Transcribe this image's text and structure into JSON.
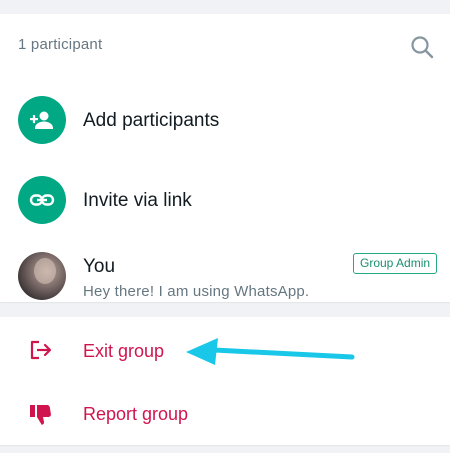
{
  "participants": {
    "count_label": "1 participant",
    "search_icon": "search-icon"
  },
  "actions": {
    "add_participants": {
      "label": "Add participants",
      "icon": "add-person-icon"
    },
    "invite_link": {
      "label": "Invite via link",
      "icon": "link-icon"
    }
  },
  "members": [
    {
      "name": "You",
      "status": "Hey there! I am using WhatsApp.",
      "badge": "Group Admin"
    }
  ],
  "group_actions": {
    "exit": {
      "label": "Exit group",
      "icon": "exit-icon"
    },
    "report": {
      "label": "Report group",
      "icon": "thumbs-down-icon"
    }
  },
  "colors": {
    "accent_green": "#00a884",
    "danger_red": "#d0154e",
    "annotation_arrow": "#19c8e8"
  }
}
